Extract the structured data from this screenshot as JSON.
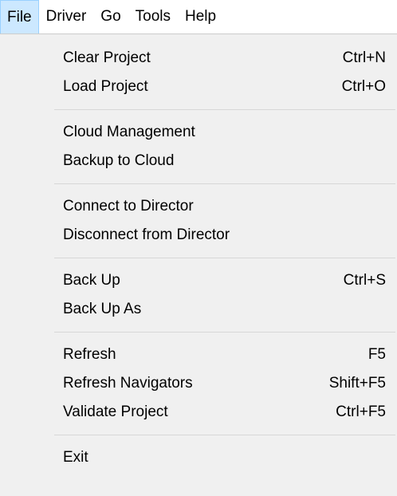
{
  "menubar": {
    "items": [
      {
        "label": "File",
        "active": true
      },
      {
        "label": "Driver",
        "active": false
      },
      {
        "label": "Go",
        "active": false
      },
      {
        "label": "Tools",
        "active": false
      },
      {
        "label": "Help",
        "active": false
      }
    ]
  },
  "file_menu": {
    "groups": [
      [
        {
          "label": "Clear Project",
          "shortcut": "Ctrl+N"
        },
        {
          "label": "Load Project",
          "shortcut": "Ctrl+O"
        }
      ],
      [
        {
          "label": "Cloud Management",
          "shortcut": ""
        },
        {
          "label": "Backup to Cloud",
          "shortcut": ""
        }
      ],
      [
        {
          "label": "Connect to Director",
          "shortcut": ""
        },
        {
          "label": "Disconnect from Director",
          "shortcut": ""
        }
      ],
      [
        {
          "label": "Back Up",
          "shortcut": "Ctrl+S"
        },
        {
          "label": "Back Up As",
          "shortcut": ""
        }
      ],
      [
        {
          "label": "Refresh",
          "shortcut": "F5"
        },
        {
          "label": "Refresh Navigators",
          "shortcut": "Shift+F5"
        },
        {
          "label": "Validate Project",
          "shortcut": "Ctrl+F5"
        }
      ],
      [
        {
          "label": "Exit",
          "shortcut": ""
        }
      ]
    ]
  },
  "colors": {
    "active_menubar_bg": "#cce8ff",
    "active_menubar_border": "#99d1ff",
    "menu_bg": "#f0f0f0",
    "separator": "#d7d7d7"
  }
}
